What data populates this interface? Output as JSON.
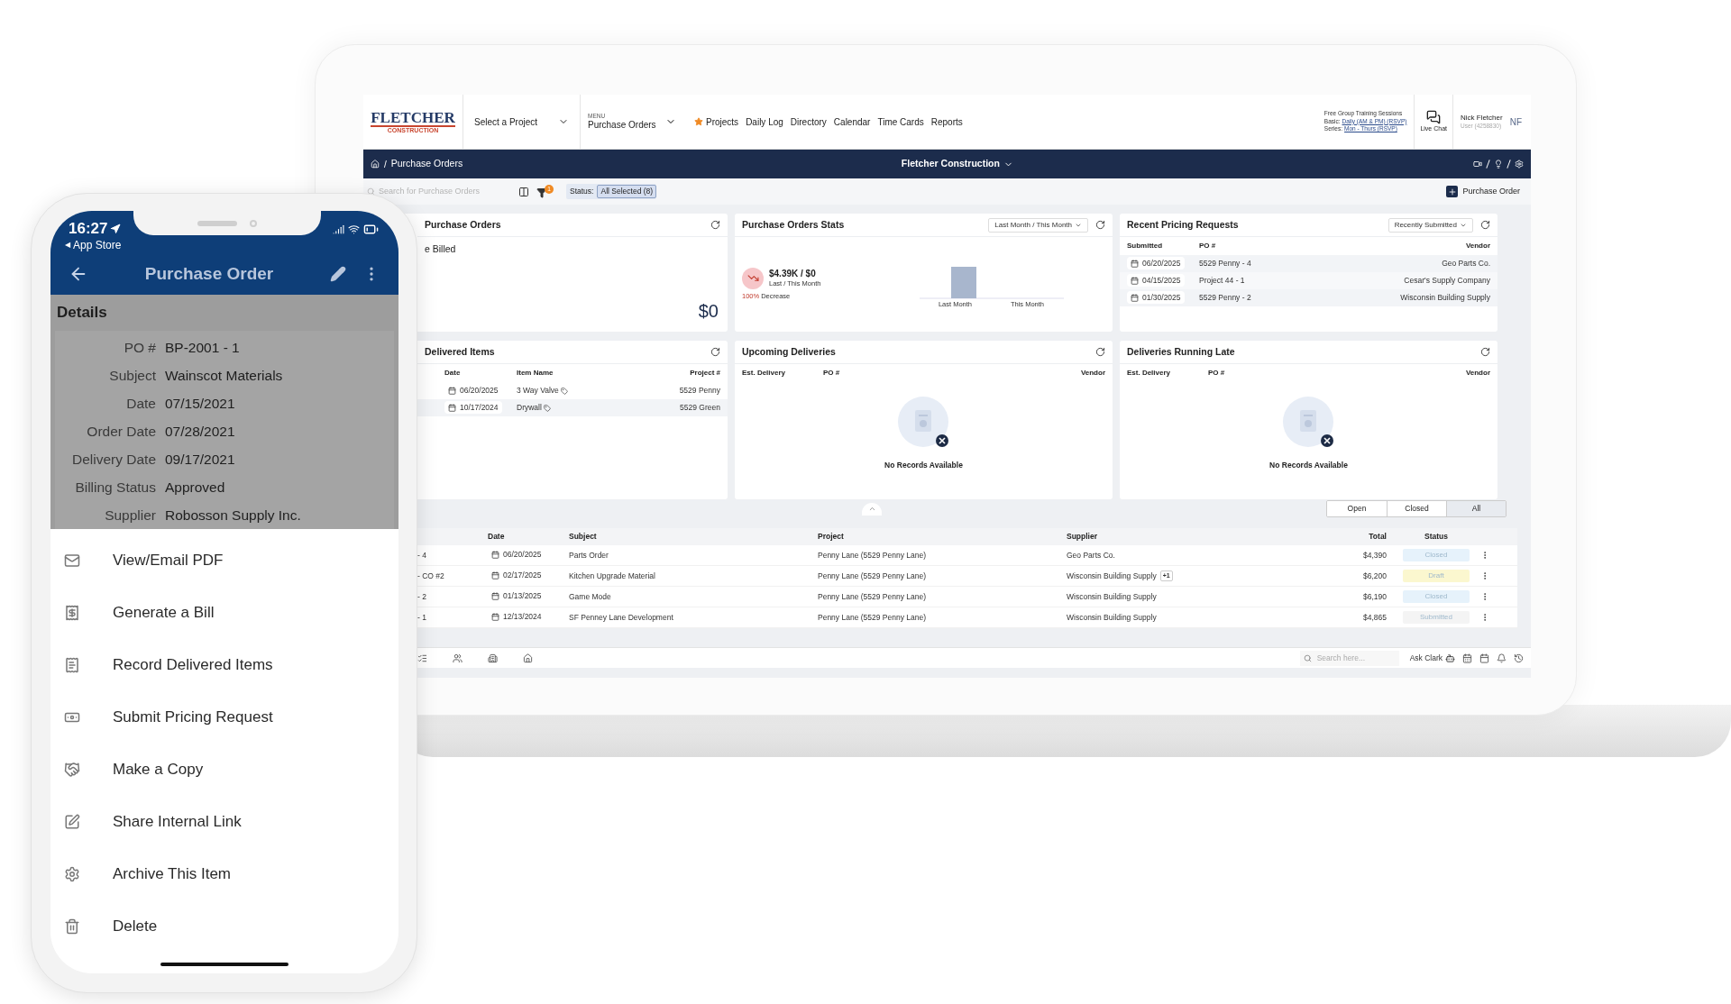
{
  "laptop": {
    "header": {
      "logo": {
        "name": "FLETCHER",
        "tagline": "CONSTRUCTION"
      },
      "project_select": {
        "placeholder": "Select a Project"
      },
      "menu": {
        "label": "MENU",
        "value": "Purchase Orders"
      },
      "nav_links": [
        {
          "label": "Projects",
          "starred": true
        },
        {
          "label": "Daily Log",
          "starred": false
        },
        {
          "label": "Directory",
          "starred": false
        },
        {
          "label": "Calendar",
          "starred": false
        },
        {
          "label": "Time Cards",
          "starred": false
        },
        {
          "label": "Reports",
          "starred": false
        }
      ],
      "training": {
        "title": "Free Group Training Sessions",
        "lines": [
          {
            "label": "Basic:",
            "link": "Daily (AM & PM) (RSVP)"
          },
          {
            "label": "Series:",
            "link": "Mon - Thurs (RSVP)"
          }
        ]
      },
      "live_chat": "Live Chat",
      "user": {
        "name": "Nick Fletcher",
        "id": "User (4258830)",
        "initials": "NF"
      }
    },
    "nav_bar": {
      "separator": "/",
      "breadcrumb": "Purchase Orders",
      "company": "Fletcher Construction"
    },
    "toolbar": {
      "search": {
        "placeholder": "Search for Purchase Orders"
      },
      "filter_count": "1",
      "status": {
        "label": "Status:",
        "value": "All Selected (8)"
      },
      "add_button": "Purchase Order"
    },
    "to_be_billed": {
      "title": "Purchase Orders",
      "subtitle": "e Billed",
      "amount": "$0"
    },
    "stats": {
      "title": "Purchase Orders Stats",
      "range": "Last Month / This Month",
      "amount": "$4.39K / $0",
      "period": "Last / This Month",
      "change": "100%",
      "change_label": "Decrease",
      "bars": [
        "Last Month",
        "This Month"
      ]
    },
    "pricing_requests": {
      "title": "Recent Pricing Requests",
      "sort": "Recently Submitted",
      "columns": [
        "Submitted",
        "PO #",
        "Vendor"
      ],
      "rows": [
        {
          "date": "06/20/2025",
          "po": "5529 Penny - 4",
          "vendor": "Geo Parts Co."
        },
        {
          "date": "04/15/2025",
          "po": "Project 44 - 1",
          "vendor": "Cesar's Supply Company"
        },
        {
          "date": "01/30/2025",
          "po": "5529 Penny - 2",
          "vendor": "Wisconsin Building Supply"
        }
      ]
    },
    "delivered_items": {
      "title": "Delivered Items",
      "columns": [
        "Date",
        "Item Name",
        "Project #"
      ],
      "rows": [
        {
          "date": "06/20/2025",
          "item": "3 Way Valve",
          "project": "5529 Penny"
        },
        {
          "date": "10/17/2024",
          "item": "Drywall",
          "project": "5529 Green"
        }
      ]
    },
    "deliveries": [
      {
        "title": "Upcoming Deliveries",
        "columns": [
          "Est. Delivery",
          "PO #",
          "Vendor"
        ],
        "empty": "No Records Available"
      },
      {
        "title": "Deliveries Running Late",
        "columns": [
          "Est. Delivery",
          "PO #",
          "Vendor"
        ],
        "empty": "No Records Available"
      }
    ],
    "filters": [
      {
        "label": "Open",
        "selected": false
      },
      {
        "label": "Closed",
        "selected": false
      },
      {
        "label": "All",
        "selected": true
      }
    ],
    "table": {
      "columns": [
        "Date",
        "Subject",
        "Project",
        "Supplier",
        "Total",
        "Status"
      ],
      "rows": [
        {
          "po": "- 4",
          "date": "06/20/2025",
          "subject": "Parts Order",
          "project": "Penny Lane (5529 Penny Lane)",
          "supplier": "Geo Parts Co.",
          "total": "$4,390",
          "status": "Closed",
          "color": "#e6f2fb"
        },
        {
          "po": "- CO #2",
          "date": "02/17/2025",
          "subject": "Kitchen Upgrade Material",
          "project": "Penny Lane (5529 Penny Lane)",
          "supplier": "Wisconsin Building Supply",
          "more": "+1",
          "total": "$6,200",
          "status": "Draft",
          "color": "#fbf7cf"
        },
        {
          "po": "- 2",
          "date": "01/13/2025",
          "subject": "Game Mode",
          "project": "Penny Lane (5529 Penny Lane)",
          "supplier": "Wisconsin Building Supply",
          "total": "$6,190",
          "status": "Closed",
          "color": "#e6f2fb"
        },
        {
          "po": "- 1",
          "date": "12/13/2024",
          "subject": "SF Penney Lane Development",
          "project": "Penny Lane (5529 Penny Lane)",
          "supplier": "Wisconsin Building Supply",
          "total": "$4,865",
          "status": "Submitted",
          "color": "#f4f4f4"
        }
      ]
    },
    "bottom_bar": {
      "search": {
        "placeholder": "Search here..."
      },
      "assistant": "Ask Clark"
    }
  },
  "phone": {
    "status_bar": {
      "time": "16:27",
      "back_arrow": "◀",
      "back_app": "App Store"
    },
    "title": "Purchase Order",
    "section": "Details",
    "fields": [
      {
        "label": "PO #",
        "value": "BP-2001 - 1"
      },
      {
        "label": "Subject",
        "value": "Wainscot Materials"
      },
      {
        "label": "Date",
        "value": "07/15/2021"
      },
      {
        "label": "Order Date",
        "value": "07/28/2021"
      },
      {
        "label": "Delivery Date",
        "value": "09/17/2021"
      },
      {
        "label": "Billing Status",
        "value": "Approved"
      },
      {
        "label": "Supplier",
        "value": "Robosson Supply Inc."
      }
    ],
    "actions": [
      "View/Email PDF",
      "Generate a Bill",
      "Record Delivered Items",
      "Submit Pricing Request",
      "Make a Copy",
      "Share Internal Link",
      "Archive This Item",
      "Delete"
    ]
  }
}
